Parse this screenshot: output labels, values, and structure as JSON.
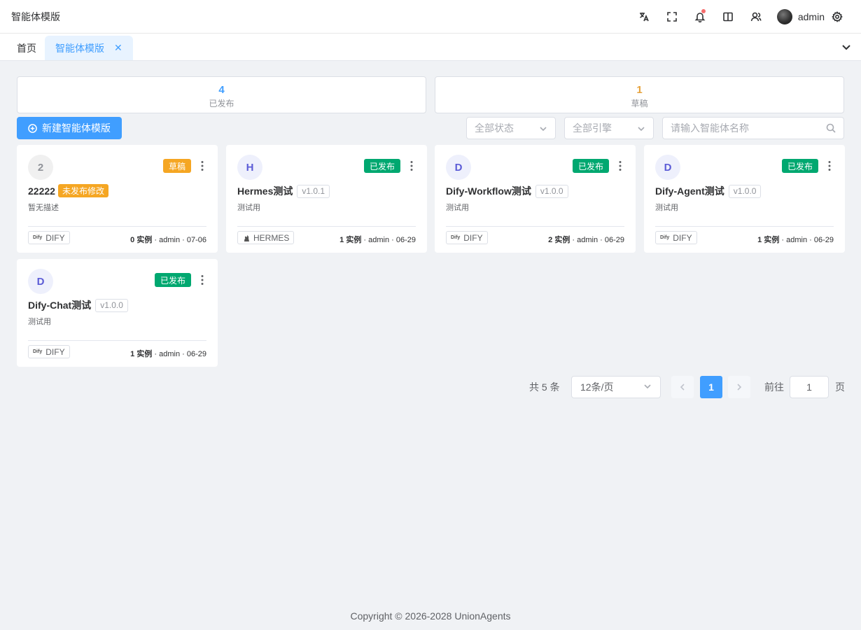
{
  "app": {
    "title": "智能体模版"
  },
  "header": {
    "user_name": "admin"
  },
  "tabs": [
    {
      "label": "首页"
    },
    {
      "label": "智能体模版",
      "close": "✕"
    }
  ],
  "stats": {
    "published": {
      "count": "4",
      "label": "已发布",
      "color": "#409eff"
    },
    "draft": {
      "count": "1",
      "label": "草稿",
      "color": "#e6a23c"
    }
  },
  "toolbar": {
    "new_button": "新建智能体模版",
    "status_filter": "全部状态",
    "engine_filter": "全部引擎",
    "search_placeholder": "请输入智能体名称"
  },
  "cards": [
    {
      "avatar": "2",
      "status": "草稿",
      "title": "22222",
      "badge": "未发布修改",
      "desc": "暂无描述",
      "engine_logo": "Dify",
      "engine": "DIFY",
      "instances": "0 实例",
      "meta": " · admin · 07-06"
    },
    {
      "avatar": "H",
      "status": "已发布",
      "title": "Hermes测试",
      "version": "v1.0.1",
      "desc": "测试用",
      "engine_logo": "",
      "engine": "HERMES",
      "instances": "1 实例",
      "meta": " · admin · 06-29"
    },
    {
      "avatar": "D",
      "status": "已发布",
      "title": "Dify-Workflow测试",
      "version": "v1.0.0",
      "desc": "测试用",
      "engine_logo": "Dify",
      "engine": "DIFY",
      "instances": "2 实例",
      "meta": " · admin · 06-29"
    },
    {
      "avatar": "D",
      "status": "已发布",
      "title": "Dify-Agent测试",
      "version": "v1.0.0",
      "desc": "测试用",
      "engine_logo": "Dify",
      "engine": "DIFY",
      "instances": "1 实例",
      "meta": " · admin · 06-29"
    },
    {
      "avatar": "D",
      "status": "已发布",
      "title": "Dify-Chat测试",
      "version": "v1.0.0",
      "desc": "测试用",
      "engine_logo": "Dify",
      "engine": "DIFY",
      "instances": "1 实例",
      "meta": " · admin · 06-29"
    }
  ],
  "colors": {
    "primary": "#409eff",
    "published": "#00a870",
    "draft": "#f5a623",
    "avatar_letter": "#5b5bd6",
    "avatar_bg": "#eef0fc",
    "avatar_num_bg": "#f0f0f0",
    "avatar_num_color": "#909399"
  },
  "pagination": {
    "total": "共 5 条",
    "page_size": "12条/页",
    "current": "1",
    "goto_label": "前往",
    "goto_value": "1",
    "goto_suffix": "页"
  },
  "footer": {
    "copyright": "Copyright © 2026-2028 UnionAgents"
  }
}
